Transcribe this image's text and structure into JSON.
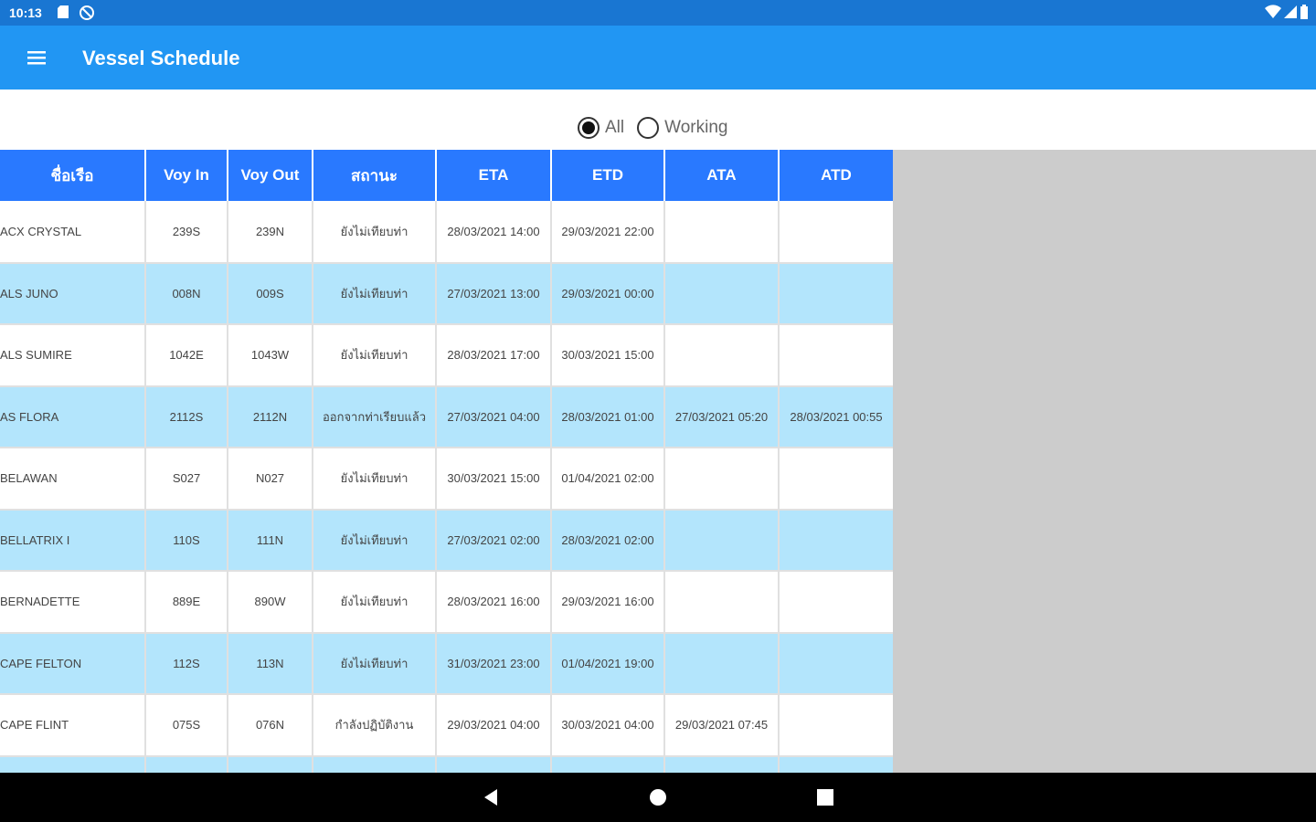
{
  "status_bar": {
    "time": "10:13"
  },
  "app_bar": {
    "title": "Vessel Schedule"
  },
  "filter": {
    "options": [
      {
        "label": "All",
        "selected": true
      },
      {
        "label": "Working",
        "selected": false
      }
    ]
  },
  "table": {
    "headers": [
      "ชื่อเรือ",
      "Voy In",
      "Voy Out",
      "สถานะ",
      "ETA",
      "ETD",
      "ATA",
      "ATD"
    ],
    "rows": [
      [
        "ACX CRYSTAL",
        "239S",
        "239N",
        "ยังไม่เทียบท่า",
        "28/03/2021 14:00",
        "29/03/2021 22:00",
        "",
        ""
      ],
      [
        "ALS JUNO",
        "008N",
        "009S",
        "ยังไม่เทียบท่า",
        "27/03/2021 13:00",
        "29/03/2021 00:00",
        "",
        ""
      ],
      [
        "ALS SUMIRE",
        "1042E",
        "1043W",
        "ยังไม่เทียบท่า",
        "28/03/2021 17:00",
        "30/03/2021 15:00",
        "",
        ""
      ],
      [
        "AS FLORA",
        "2112S",
        "2112N",
        "ออกจากท่าเรียบแล้ว",
        "27/03/2021 04:00",
        "28/03/2021 01:00",
        "27/03/2021 05:20",
        "28/03/2021 00:55"
      ],
      [
        "BELAWAN",
        "S027",
        "N027",
        "ยังไม่เทียบท่า",
        "30/03/2021 15:00",
        "01/04/2021 02:00",
        "",
        ""
      ],
      [
        "BELLATRIX I",
        "110S",
        "111N",
        "ยังไม่เทียบท่า",
        "27/03/2021 02:00",
        "28/03/2021 02:00",
        "",
        ""
      ],
      [
        "BERNADETTE",
        "889E",
        "890W",
        "ยังไม่เทียบท่า",
        "28/03/2021 16:00",
        "29/03/2021 16:00",
        "",
        ""
      ],
      [
        "CAPE FELTON",
        "112S",
        "113N",
        "ยังไม่เทียบท่า",
        "31/03/2021 23:00",
        "01/04/2021 19:00",
        "",
        ""
      ],
      [
        "CAPE FLINT",
        "075S",
        "076N",
        "กำลังปฏิบัติงาน",
        "29/03/2021 04:00",
        "30/03/2021 04:00",
        "29/03/2021 07:45",
        ""
      ],
      [
        "",
        "",
        "",
        "",
        "",
        "",
        "",
        ""
      ]
    ]
  },
  "colors": {
    "status_bar": "#1976d2",
    "app_bar": "#2196f3",
    "table_header": "#2979ff",
    "row_alt": "#b3e5fc",
    "empty_area": "#cccccc"
  }
}
